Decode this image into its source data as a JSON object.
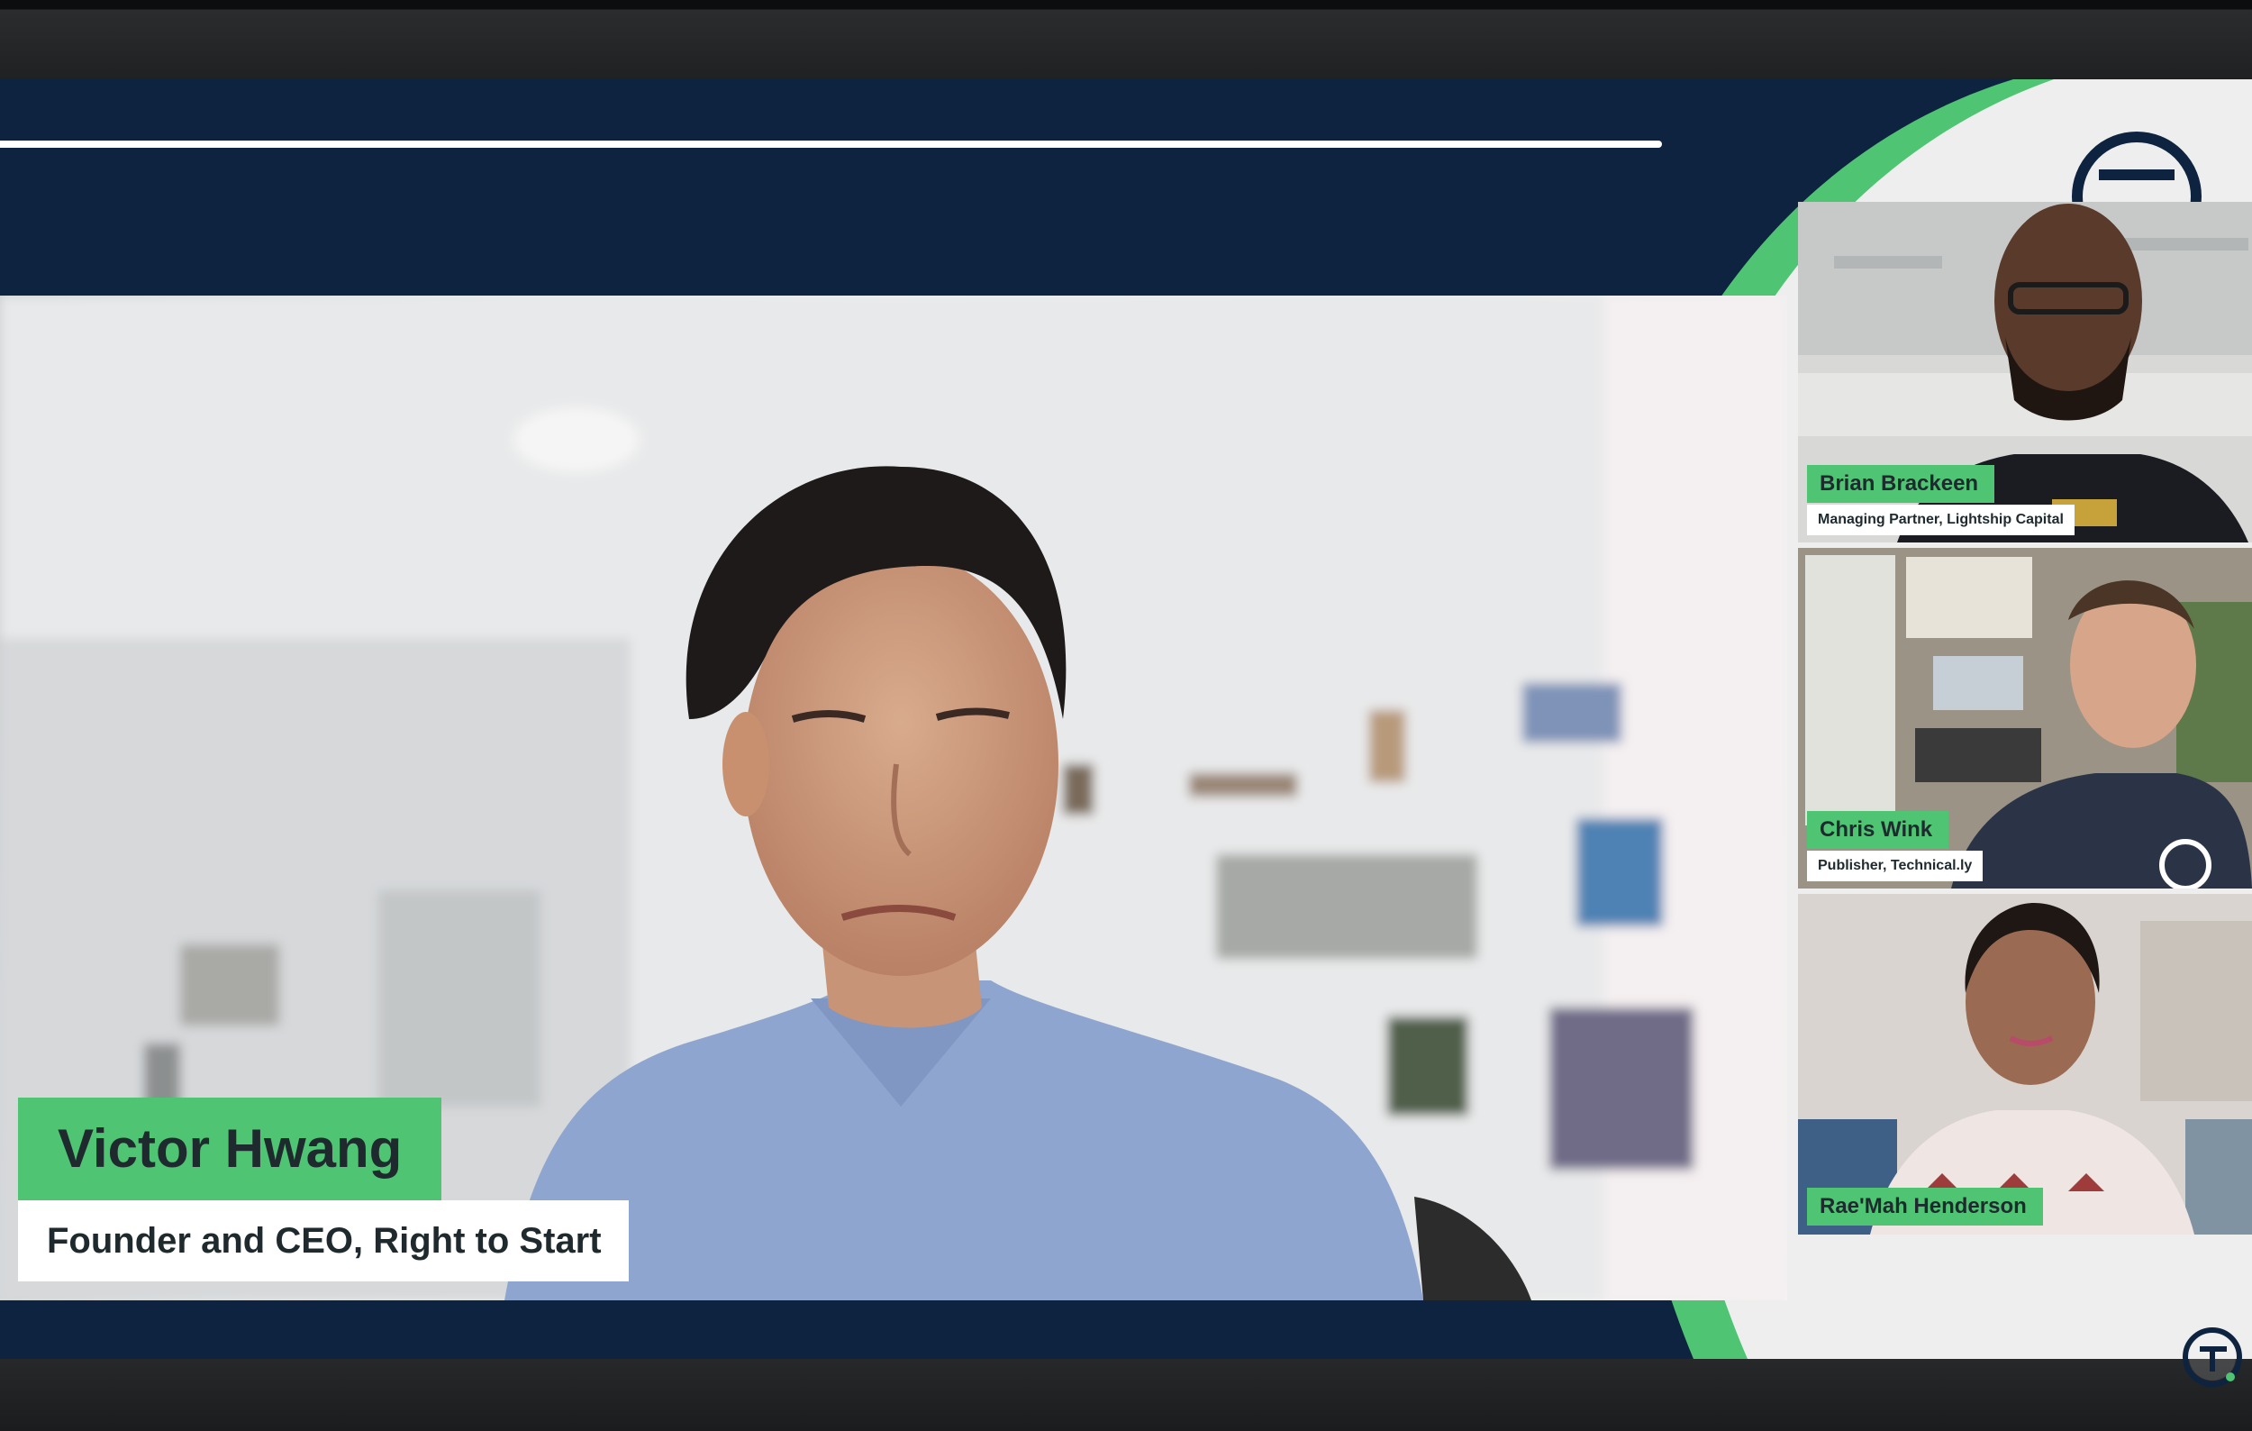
{
  "main_speaker": {
    "name": "Victor Hwang",
    "title": "Founder and CEO, Right to Start"
  },
  "panelists": [
    {
      "name": "Brian Brackeen",
      "title": "Managing Partner, Lightship Capital"
    },
    {
      "name": "Chris Wink",
      "title": "Publisher, Technical.ly"
    },
    {
      "name": "Rae'Mah Henderson",
      "title": ""
    }
  ],
  "colors": {
    "navy": "#0e2340",
    "accent_green": "#4fc472",
    "label_text": "#1f2a2e",
    "white": "#ffffff"
  },
  "icons": [
    "technically-logo-icon"
  ]
}
